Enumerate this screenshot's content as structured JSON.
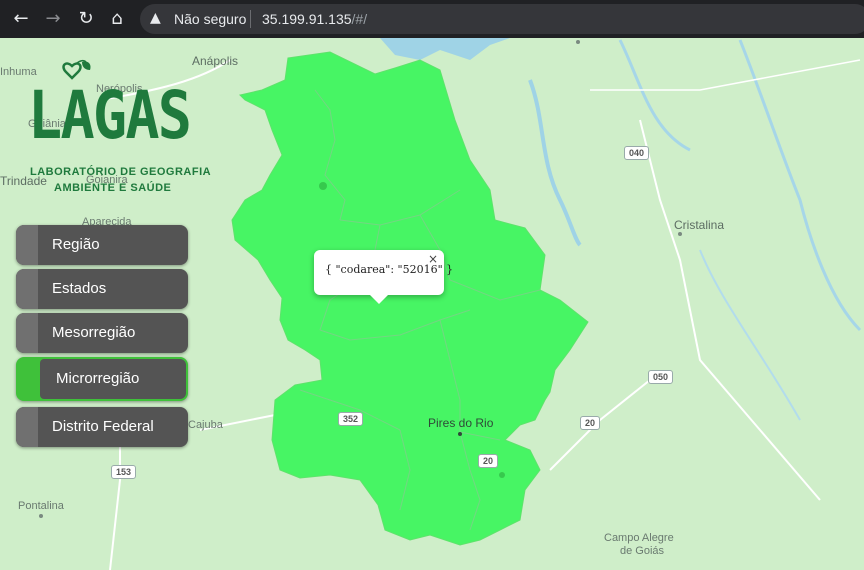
{
  "browser": {
    "warning_icon": "warning-triangle-icon",
    "not_secure": "Não seguro",
    "url_host": "35.199.91.135",
    "url_path": "/#/"
  },
  "map": {
    "places": {
      "inhuma": "Inhuma",
      "neropolis": "Nerópolis",
      "anapolis": "Anápolis",
      "goiania": "Goiânia",
      "trindade": "Trindade",
      "goianira": "Goianira",
      "aparecida": "Aparecida",
      "cristalina": "Cristalina",
      "pires_do_rio": "Pires do Rio",
      "cajuba": "Cajuba",
      "pontalina": "Pontalina",
      "campo_alegre_1": "Campo Alegre",
      "campo_alegre_2": "de Goiás"
    },
    "roads": {
      "r040": "040",
      "r050": "050",
      "r352": "352",
      "r20a": "20",
      "r20b": "20",
      "r153": "153"
    },
    "region_color": "#47f564",
    "background_color": "#cfeec9"
  },
  "logo": {
    "title": "LAGAS",
    "line1": "LABORATÓRIO DE GEOGRAFIA",
    "line2": "AMBIENTE E SAÚDE",
    "color": "#1f7a3d"
  },
  "menu": {
    "regiao": "Região",
    "estados": "Estados",
    "mesorregiao": "Mesorregião",
    "microrregiao": "Microrregião",
    "distrito_federal": "Distrito Federal",
    "active_color": "#3fc13a"
  },
  "popup": {
    "text": "{ \"codarea\": \"52016\" }",
    "close": "×"
  }
}
